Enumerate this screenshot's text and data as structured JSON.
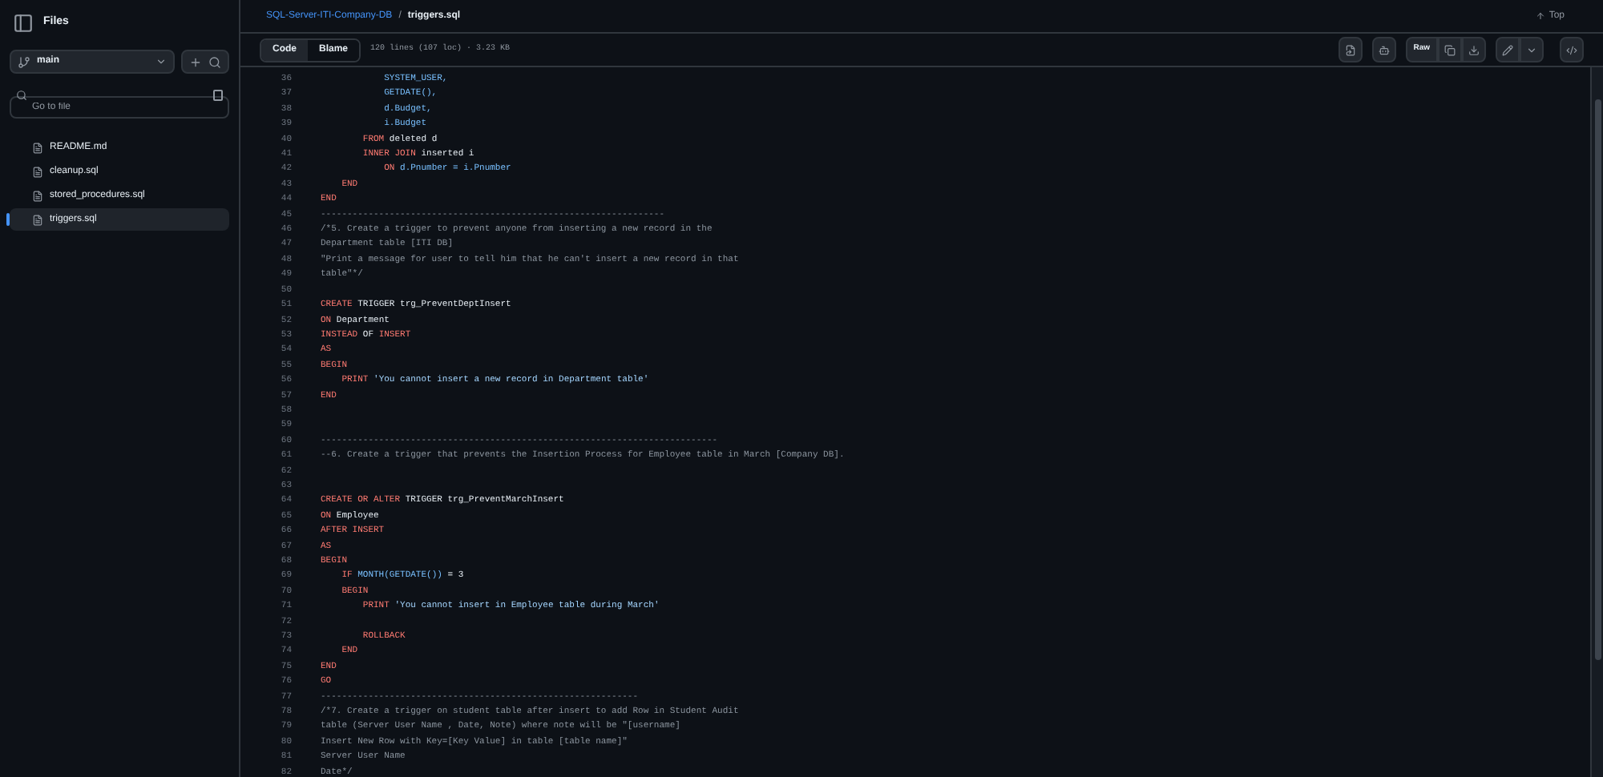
{
  "sidebar": {
    "title": "Files",
    "branch": "main",
    "search": {
      "placeholder": "Go to file"
    },
    "files": [
      {
        "name": "README.md",
        "selected": false
      },
      {
        "name": "cleanup.sql",
        "selected": false
      },
      {
        "name": "stored_procedures.sql",
        "selected": false
      },
      {
        "name": "triggers.sql",
        "selected": true
      }
    ]
  },
  "breadcrumb": {
    "repo": "SQL-Server-ITI-Company-DB",
    "separator": "/",
    "file": "triggers.sql"
  },
  "top_link": "Top",
  "tabs": [
    {
      "label": "Code",
      "selected": true
    },
    {
      "label": "Blame",
      "selected": false
    }
  ],
  "file_info": "120 lines (107 loc) · 3.23 KB",
  "raw_button": "Raw",
  "lines": [
    {
      "number": "36",
      "tokens": [
        {
          "kind": "func",
          "text": "            SYSTEM_USER,"
        }
      ]
    },
    {
      "number": "37",
      "tokens": [
        {
          "kind": "func",
          "text": "            GETDATE(),"
        }
      ]
    },
    {
      "number": "38",
      "tokens": [
        {
          "kind": "func",
          "text": "            d.Budget,"
        }
      ]
    },
    {
      "number": "39",
      "tokens": [
        {
          "kind": "func",
          "text": "            i.Budget"
        }
      ]
    },
    {
      "number": "40",
      "tokens": [
        {
          "kind": "kw",
          "text": "        FROM"
        },
        {
          "kind": "plain",
          "text": " deleted d"
        }
      ]
    },
    {
      "number": "41",
      "tokens": [
        {
          "kind": "kw",
          "text": "        INNER JOIN"
        },
        {
          "kind": "plain",
          "text": " inserted i"
        }
      ]
    },
    {
      "number": "42",
      "tokens": [
        {
          "kind": "kw",
          "text": "            ON"
        },
        {
          "kind": "func",
          "text": " d.Pnumber = i.Pnumber"
        }
      ]
    },
    {
      "number": "43",
      "tokens": [
        {
          "kind": "kw",
          "text": "    END"
        }
      ]
    },
    {
      "number": "44",
      "tokens": [
        {
          "kind": "kw",
          "text": "END"
        }
      ]
    },
    {
      "number": "45",
      "tokens": [
        {
          "kind": "comment",
          "text": "-----------------------------------------------------------------"
        }
      ]
    },
    {
      "number": "46",
      "tokens": [
        {
          "kind": "comment",
          "text": "/*5. Create a trigger to prevent anyone from inserting a new record in the"
        }
      ]
    },
    {
      "number": "47",
      "tokens": [
        {
          "kind": "comment",
          "text": "Department table [ITI DB]"
        }
      ]
    },
    {
      "number": "48",
      "tokens": [
        {
          "kind": "comment",
          "text": "\"Print a message for user to tell him that he can't insert a new record in that"
        }
      ]
    },
    {
      "number": "49",
      "tokens": [
        {
          "kind": "comment",
          "text": "table\"*/"
        }
      ]
    },
    {
      "number": "50"
    },
    {
      "number": "51",
      "tokens": [
        {
          "kind": "kw",
          "text": "CREATE"
        },
        {
          "kind": "plain",
          "text": " TRIGGER trg_PreventDeptInsert"
        }
      ]
    },
    {
      "number": "52",
      "tokens": [
        {
          "kind": "kw",
          "text": "ON"
        },
        {
          "kind": "plain",
          "text": " Department"
        }
      ]
    },
    {
      "number": "53",
      "tokens": [
        {
          "kind": "kw",
          "text": "INSTEAD"
        },
        {
          "kind": "plain",
          "text": " OF "
        },
        {
          "kind": "kw",
          "text": "INSERT"
        }
      ]
    },
    {
      "number": "54",
      "tokens": [
        {
          "kind": "kw",
          "text": "AS"
        }
      ]
    },
    {
      "number": "55",
      "tokens": [
        {
          "kind": "kw",
          "text": "BEGIN"
        }
      ]
    },
    {
      "number": "56",
      "tokens": [
        {
          "kind": "kw",
          "text": "    PRINT"
        },
        {
          "kind": "string",
          "text": " 'You cannot insert a new record in Department table'"
        }
      ]
    },
    {
      "number": "57",
      "tokens": [
        {
          "kind": "kw",
          "text": "END"
        }
      ]
    },
    {
      "number": "58"
    },
    {
      "number": "59"
    },
    {
      "number": "60",
      "tokens": [
        {
          "kind": "comment",
          "text": "---------------------------------------------------------------------------"
        }
      ]
    },
    {
      "number": "61",
      "tokens": [
        {
          "kind": "comment",
          "text": "--6. Create a trigger that prevents the Insertion Process for Employee table in March [Company DB]."
        }
      ]
    },
    {
      "number": "62"
    },
    {
      "number": "63"
    },
    {
      "number": "64",
      "tokens": [
        {
          "kind": "kw",
          "text": "CREATE OR ALTER"
        },
        {
          "kind": "plain",
          "text": " TRIGGER trg_PreventMarchInsert"
        }
      ]
    },
    {
      "number": "65",
      "tokens": [
        {
          "kind": "kw",
          "text": "ON"
        },
        {
          "kind": "plain",
          "text": " Employee"
        }
      ]
    },
    {
      "number": "66",
      "tokens": [
        {
          "kind": "kw",
          "text": "AFTER INSERT"
        }
      ]
    },
    {
      "number": "67",
      "tokens": [
        {
          "kind": "kw",
          "text": "AS"
        }
      ]
    },
    {
      "number": "68",
      "tokens": [
        {
          "kind": "kw",
          "text": "BEGIN"
        }
      ]
    },
    {
      "number": "69",
      "tokens": [
        {
          "kind": "kw",
          "text": "    IF "
        },
        {
          "kind": "func",
          "text": "MONTH(GETDATE())"
        },
        {
          "kind": "plain",
          "text": " = 3"
        }
      ]
    },
    {
      "number": "70",
      "tokens": [
        {
          "kind": "kw",
          "text": "    BEGIN"
        }
      ]
    },
    {
      "number": "71",
      "tokens": [
        {
          "kind": "kw",
          "text": "        PRINT"
        },
        {
          "kind": "string",
          "text": " 'You cannot insert in Employee table during March'"
        }
      ]
    },
    {
      "number": "72"
    },
    {
      "number": "73",
      "tokens": [
        {
          "kind": "kw",
          "text": "        ROLLBACK"
        }
      ]
    },
    {
      "number": "74",
      "tokens": [
        {
          "kind": "kw",
          "text": "    END"
        }
      ]
    },
    {
      "number": "75",
      "tokens": [
        {
          "kind": "kw",
          "text": "END"
        }
      ]
    },
    {
      "number": "76",
      "tokens": [
        {
          "kind": "kw",
          "text": "GO"
        }
      ]
    },
    {
      "number": "77",
      "tokens": [
        {
          "kind": "comment",
          "text": "------------------------------------------------------------"
        }
      ]
    },
    {
      "number": "78",
      "tokens": [
        {
          "kind": "comment",
          "text": "/*7. Create a trigger on student table after insert to add Row in Student Audit"
        }
      ]
    },
    {
      "number": "79",
      "tokens": [
        {
          "kind": "comment",
          "text": "table (Server User Name , Date, Note) where note will be \"[username]"
        }
      ]
    },
    {
      "number": "80",
      "tokens": [
        {
          "kind": "comment",
          "text": "Insert New Row with Key=[Key Value] in table [table name]\""
        }
      ]
    },
    {
      "number": "81",
      "tokens": [
        {
          "kind": "comment",
          "text": "Server User Name"
        }
      ]
    },
    {
      "number": "82",
      "tokens": [
        {
          "kind": "comment",
          "text": "Date*/"
        }
      ]
    }
  ]
}
